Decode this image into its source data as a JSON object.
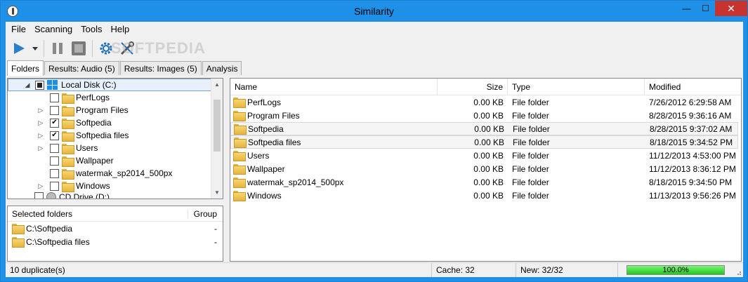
{
  "window": {
    "title": "Similarity",
    "minimize": "—",
    "maximize": "☐",
    "close": "✕"
  },
  "menu": [
    "File",
    "Scanning",
    "Tools",
    "Help"
  ],
  "watermark": "SOFTPEDIA",
  "tabs": [
    {
      "label": "Folders",
      "active": true
    },
    {
      "label": "Results: Audio (5)",
      "active": false
    },
    {
      "label": "Results: Images (5)",
      "active": false
    },
    {
      "label": "Analysis",
      "active": false
    }
  ],
  "tree": {
    "root": {
      "label": "Local Disk (C:)",
      "expander": "◢"
    },
    "items": [
      {
        "label": "PerfLogs",
        "checked": false,
        "expander": ""
      },
      {
        "label": "Program Files",
        "checked": false,
        "expander": "▷"
      },
      {
        "label": "Softpedia",
        "checked": true,
        "expander": "▷"
      },
      {
        "label": "Softpedia files",
        "checked": true,
        "expander": "▷"
      },
      {
        "label": "Users",
        "checked": false,
        "expander": "▷"
      },
      {
        "label": "Wallpaper",
        "checked": false,
        "expander": ""
      },
      {
        "label": "watermak_sp2014_500px",
        "checked": false,
        "expander": ""
      },
      {
        "label": "Windows",
        "checked": false,
        "expander": "▷"
      }
    ],
    "cut_item": "CD Drive (D:)",
    "check_mark": "✔"
  },
  "selected_folders": {
    "headers": {
      "folder": "Selected folders",
      "group": "Group"
    },
    "rows": [
      {
        "path": "C:\\Softpedia",
        "group": "-"
      },
      {
        "path": "C:\\Softpedia files",
        "group": "-"
      }
    ]
  },
  "list": {
    "headers": {
      "name": "Name",
      "size": "Size",
      "type": "Type",
      "modified": "Modified"
    },
    "rows": [
      {
        "name": "PerfLogs",
        "size": "0.00 KB",
        "type": "File folder",
        "modified": "7/26/2012 6:29:58 AM",
        "highlight": false
      },
      {
        "name": "Program Files",
        "size": "0.00 KB",
        "type": "File folder",
        "modified": "8/28/2015 9:36:16 AM",
        "highlight": false
      },
      {
        "name": "Softpedia",
        "size": "0.00 KB",
        "type": "File folder",
        "modified": "8/28/2015 9:37:02 AM",
        "highlight": true
      },
      {
        "name": "Softpedia files",
        "size": "0.00 KB",
        "type": "File folder",
        "modified": "8/18/2015 9:34:52 PM",
        "highlight": true
      },
      {
        "name": "Users",
        "size": "0.00 KB",
        "type": "File folder",
        "modified": "11/12/2013 4:53:00 PM",
        "highlight": false
      },
      {
        "name": "Wallpaper",
        "size": "0.00 KB",
        "type": "File folder",
        "modified": "11/12/2013 8:36:12 PM",
        "highlight": false
      },
      {
        "name": "watermak_sp2014_500px",
        "size": "0.00 KB",
        "type": "File folder",
        "modified": "8/18/2015 9:34:50 PM",
        "highlight": false
      },
      {
        "name": "Windows",
        "size": "0.00 KB",
        "type": "File folder",
        "modified": "11/13/2013 9:56:26 PM",
        "highlight": false
      }
    ]
  },
  "status": {
    "duplicates": "10 duplicate(s)",
    "cache": "Cache: 32",
    "new": "New: 32/32",
    "progress_text": "100.0%",
    "progress_value": 1.0
  },
  "colors": {
    "accent": "#1e90e8",
    "progress": "#1fc81a",
    "close": "#c7332e"
  }
}
